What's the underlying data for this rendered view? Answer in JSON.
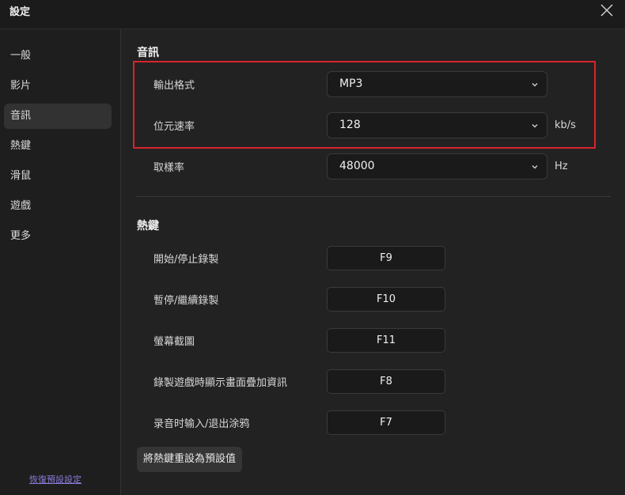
{
  "window": {
    "title": "設定"
  },
  "sidebar": {
    "items": [
      {
        "label": "一般",
        "active": false
      },
      {
        "label": "影片",
        "active": false
      },
      {
        "label": "音訊",
        "active": true
      },
      {
        "label": "熱鍵",
        "active": false
      },
      {
        "label": "滑鼠",
        "active": false
      },
      {
        "label": "遊戲",
        "active": false
      },
      {
        "label": "更多",
        "active": false
      }
    ],
    "reset_link": "恢復預設設定"
  },
  "audio": {
    "section_title": "音訊",
    "format": {
      "label": "輸出格式",
      "value": "MP3"
    },
    "bitrate": {
      "label": "位元速率",
      "value": "128",
      "unit": "kb/s"
    },
    "samplerate": {
      "label": "取樣率",
      "value": "48000",
      "unit": "Hz"
    }
  },
  "hotkeys": {
    "section_title": "熱鍵",
    "items": [
      {
        "label": "開始/停止錄製",
        "key": "F9"
      },
      {
        "label": "暫停/繼續錄製",
        "key": "F10"
      },
      {
        "label": "螢幕截圖",
        "key": "F11"
      },
      {
        "label": "錄製遊戲時顯示畫面疊加資訊",
        "key": "F8"
      },
      {
        "label": "录音时输入/退出涂鸦",
        "key": "F7"
      }
    ],
    "reset_button": "將熱鍵重設為預設值"
  },
  "colors": {
    "highlight": "#d9242a",
    "link": "#8c7bd9",
    "active_nav": "#323232"
  }
}
